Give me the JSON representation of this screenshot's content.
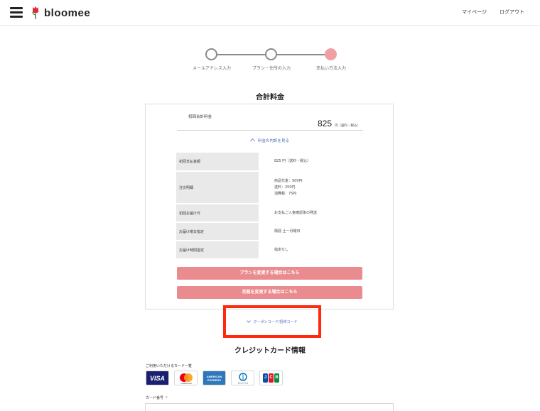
{
  "header": {
    "logo_text": "bloomee",
    "nav": [
      {
        "label": "マイページ"
      },
      {
        "label": "ログアウト"
      }
    ]
  },
  "stepper": {
    "steps": [
      {
        "label": "メールアドレス入力",
        "state": "done"
      },
      {
        "label": "プラン・住所の入力",
        "state": "done"
      },
      {
        "label": "支払い方法入力",
        "state": "current"
      }
    ]
  },
  "summary": {
    "title": "合計料金",
    "total_label": "初回合計料金",
    "total_amount": "825",
    "total_unit": "円（送料・税込）",
    "breakdown_toggle": "料金の内訳を見る",
    "rows": [
      {
        "label": "初回支払金額",
        "value": [
          "825 円（送料・税込）"
        ]
      },
      {
        "label": "注文明細",
        "value": [
          "商品代金：500円",
          "送料：250円",
          "消費税：75円"
        ]
      },
      {
        "label": "初回お届け日",
        "value": [
          "お支払ご入金確認後の発送"
        ]
      },
      {
        "label": "お届け曜日指定",
        "value": [
          "隔週 土ー月曜日"
        ]
      },
      {
        "label": "お届け時間指定",
        "value": [
          "指定なし"
        ]
      }
    ],
    "change_plan_button": "プランを変更する場合はこちら",
    "change_vase_button": "花瓶を変更する場合はこちら"
  },
  "coupon": {
    "label": "クーポンコード/招待コード"
  },
  "credit": {
    "title": "クレジットカード情報",
    "available_label": "ご利用いただけるカード一覧",
    "brands": [
      "VISA",
      "mastercard",
      "AMERICAN EXPRESS",
      "Diners Club",
      "JCB"
    ],
    "card_number_label": "カード番号",
    "required_mark": "*"
  },
  "colors": {
    "accent_pink": "#ea8c8f",
    "step_active": "#f0a0a5",
    "link_blue": "#4a6bb5",
    "highlight_red": "#ff2a0e"
  }
}
